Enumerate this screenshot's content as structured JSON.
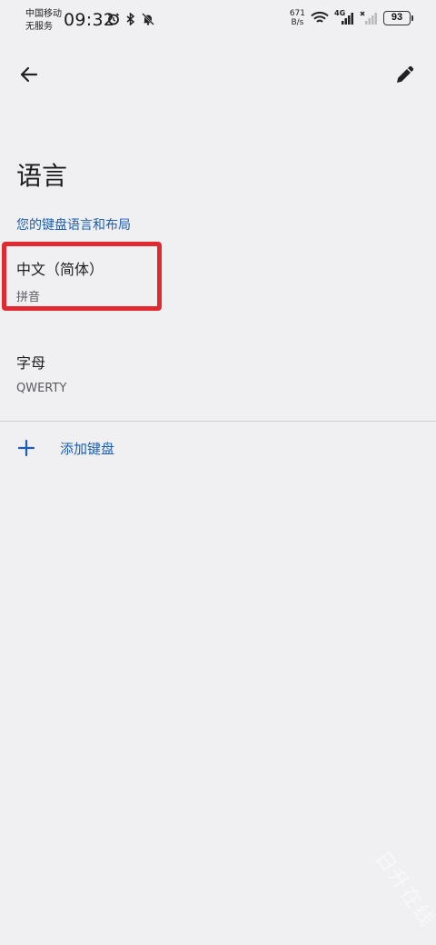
{
  "status_bar": {
    "carrier_line1": "中国移动",
    "carrier_line2": "无服务",
    "time": "09:32",
    "net_speed_value": "671",
    "net_speed_unit": "B/s",
    "network_type": "4G",
    "battery": "93"
  },
  "icons": {
    "back": "arrow-back-icon",
    "edit": "pencil-icon",
    "add": "plus-icon",
    "alarm": "alarm-icon",
    "bluetooth": "bluetooth-icon",
    "mute": "bell-off-icon",
    "wifi": "wifi-icon"
  },
  "colors": {
    "accent": "#1a5fb4",
    "highlight": "#e02a2f",
    "background": "#f0eff2"
  },
  "page": {
    "title": "语言",
    "section_header": "您的键盘语言和布局"
  },
  "keyboards": [
    {
      "title": "中文（简体）",
      "subtitle": "拼音"
    },
    {
      "title": "字母",
      "subtitle": "QWERTY"
    }
  ],
  "add_keyboard": {
    "label": "添加键盘"
  },
  "watermark": "日升在线"
}
